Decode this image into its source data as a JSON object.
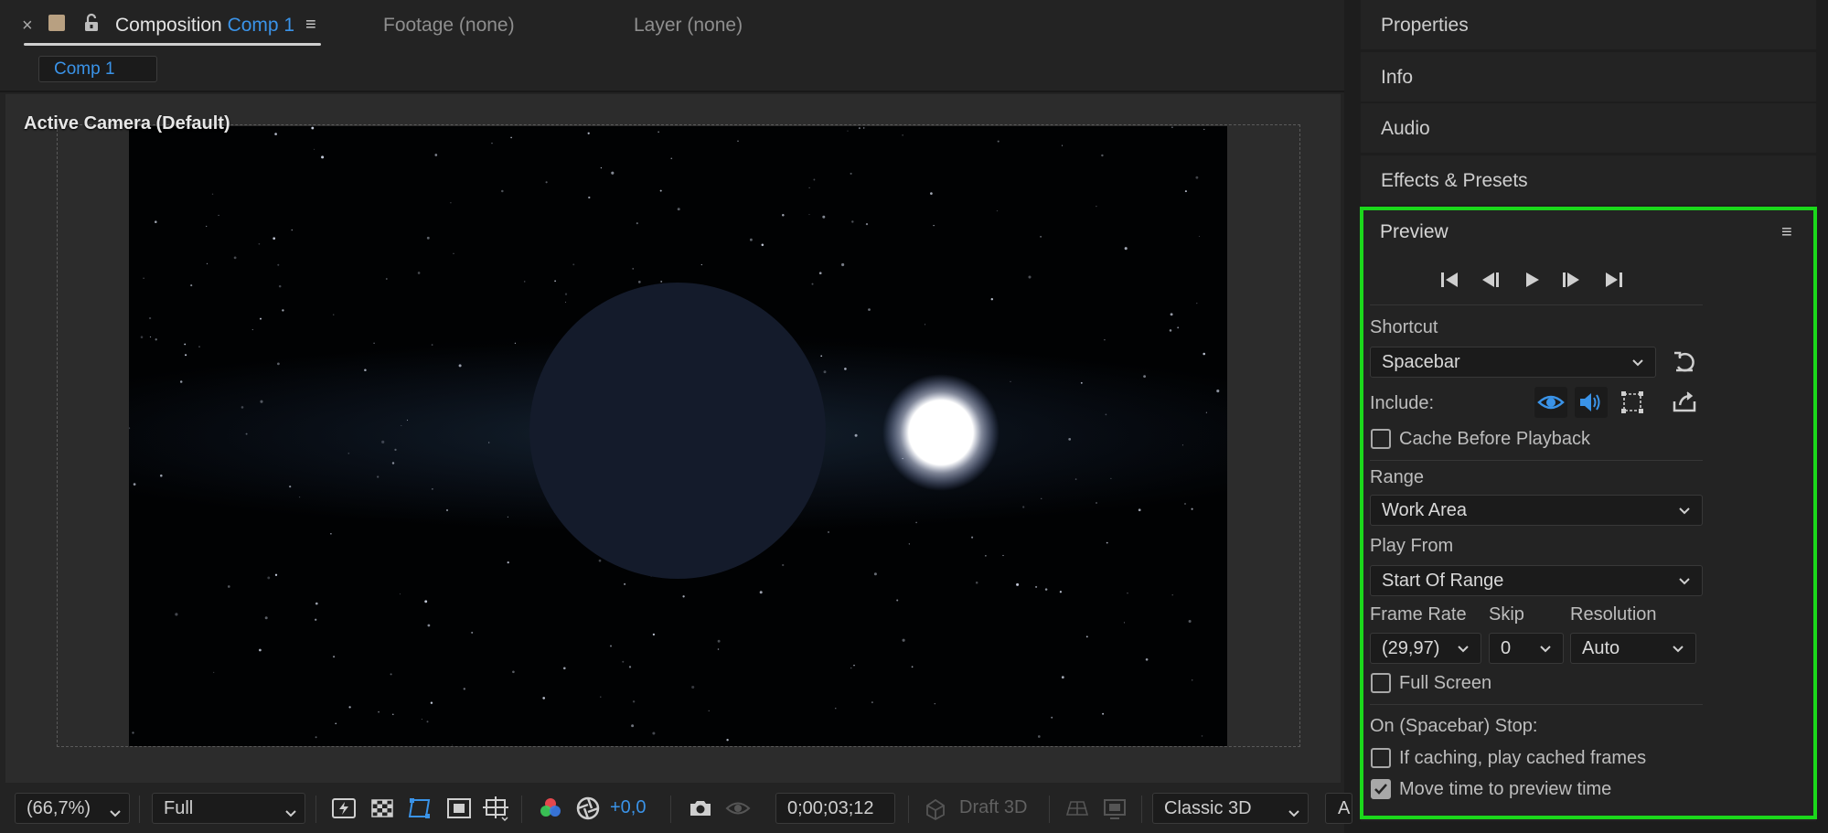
{
  "colors": {
    "accent": "#3a93e8",
    "highlight_frame": "#1bd81b",
    "panel_bg": "#232323"
  },
  "comp_tabs": {
    "close_glyph": "×",
    "composition_prefix": "Composition",
    "composition_name": "Comp 1",
    "menu_glyph": "≡",
    "footage": "Footage (none)",
    "layer": "Layer (none)"
  },
  "comp_subtab": "Comp 1",
  "viewer": {
    "camera_label": "Active Camera (Default)"
  },
  "viewer_toolbar": {
    "magnification": "(66,7%)",
    "resolution": "Full",
    "exposure": "+0,0",
    "timecode": "0;00;03;12",
    "draft_3d": "Draft 3D",
    "renderer": "Classic 3D",
    "truncated": "A"
  },
  "side_panels": [
    "Properties",
    "Info",
    "Audio",
    "Effects & Presets"
  ],
  "preview": {
    "title": "Preview",
    "menu_glyph": "≡",
    "transport": [
      "first-frame-icon",
      "previous-frame-icon",
      "play-icon",
      "next-frame-icon",
      "last-frame-icon"
    ],
    "shortcut_label": "Shortcut",
    "shortcut_value": "Spacebar",
    "include_label": "Include:",
    "include_icons": [
      "video-eye-icon",
      "audio-speaker-icon",
      "overlays-icon"
    ],
    "cache_before_playback": {
      "label": "Cache Before Playback",
      "checked": false
    },
    "range_label": "Range",
    "range_value": "Work Area",
    "play_from_label": "Play From",
    "play_from_value": "Start Of Range",
    "frame_rate_label": "Frame Rate",
    "frame_rate_value": "(29,97)",
    "skip_label": "Skip",
    "skip_value": "0",
    "resolution_label": "Resolution",
    "resolution_value": "Auto",
    "full_screen": {
      "label": "Full Screen",
      "checked": false
    },
    "stop_label": "On (Spacebar) Stop:",
    "if_caching": {
      "label": "If caching, play cached frames",
      "checked": false
    },
    "move_time": {
      "label": "Move time to preview time",
      "checked": true
    }
  }
}
